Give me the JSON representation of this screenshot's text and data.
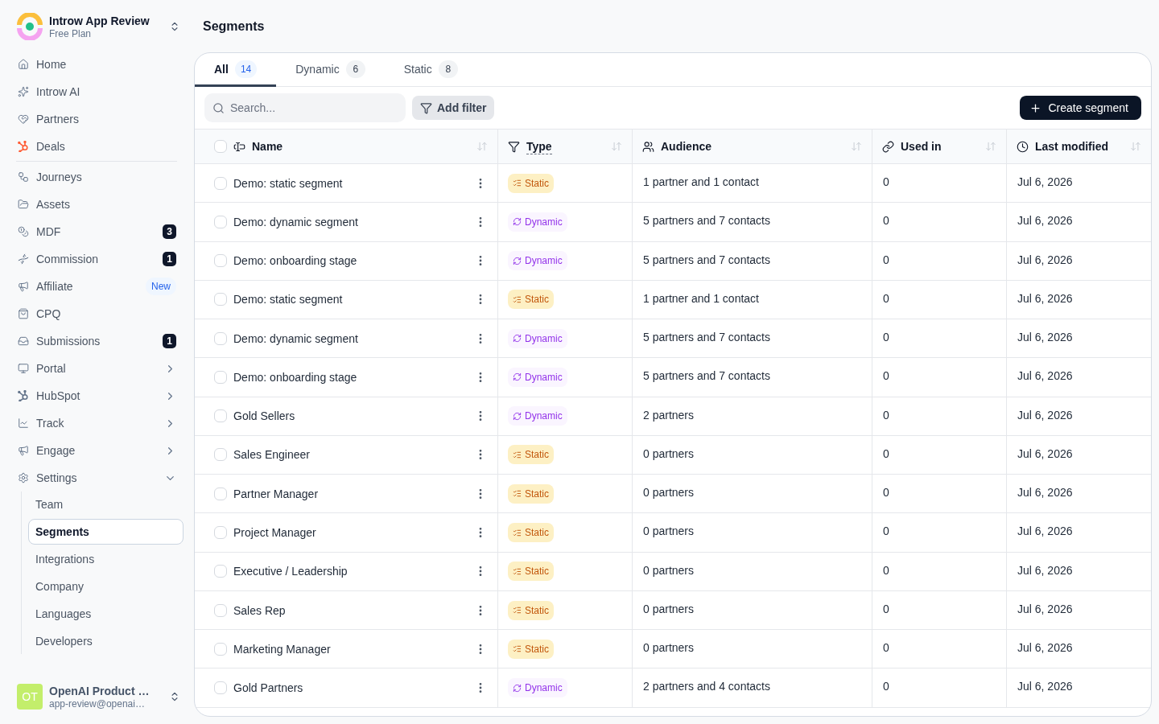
{
  "workspace": {
    "name": "Introw App Review",
    "plan": "Free Plan"
  },
  "sidebar": {
    "sections": [
      {
        "items": [
          {
            "label": "Home",
            "selected": false
          },
          {
            "label": "Introw AI",
            "selected": false
          },
          {
            "label": "Partners",
            "selected": false
          },
          {
            "label": "Deals",
            "selected": false
          }
        ]
      },
      {
        "items": [
          {
            "label": "Journeys",
            "selected": false
          },
          {
            "label": "Assets",
            "selected": false
          },
          {
            "label": "MDF",
            "selected": false,
            "badge": {
              "text": "3",
              "kind": "count"
            }
          },
          {
            "label": "Commission",
            "selected": false,
            "badge": {
              "text": "1",
              "kind": "count"
            }
          },
          {
            "label": "Affiliate",
            "selected": false,
            "badge": {
              "text": "New",
              "kind": "new"
            }
          },
          {
            "label": "CPQ",
            "selected": false
          },
          {
            "label": "Submissions",
            "selected": false,
            "badge": {
              "text": "1",
              "kind": "count"
            }
          },
          {
            "label": "Portal",
            "selected": false,
            "expanded": false
          },
          {
            "label": "HubSpot",
            "selected": false,
            "expanded": false
          },
          {
            "label": "Track",
            "selected": false,
            "expanded": false
          },
          {
            "label": "Engage",
            "selected": false,
            "expanded": false
          },
          {
            "label": "Settings",
            "selected": false,
            "expanded": true,
            "children": [
              {
                "label": "Team",
                "selected": false
              },
              {
                "label": "Segments",
                "selected": true
              },
              {
                "label": "Integrations",
                "selected": false
              },
              {
                "label": "Company",
                "selected": false
              },
              {
                "label": "Languages",
                "selected": false
              },
              {
                "label": "Developers",
                "selected": false
              }
            ]
          }
        ]
      }
    ]
  },
  "account": {
    "initials": "OT",
    "name": "OpenAI Product …",
    "email": "app-review@openai…"
  },
  "page": {
    "title": "Segments"
  },
  "tabs": [
    {
      "label": "All",
      "count": "14",
      "selected": true
    },
    {
      "label": "Dynamic",
      "count": "6",
      "selected": false
    },
    {
      "label": "Static",
      "count": "8",
      "selected": false
    }
  ],
  "toolbar": {
    "search": {
      "placeholder": "Search..."
    },
    "filter_button": "Add filter",
    "create_button": "Create segment"
  },
  "table": {
    "select_all_checked": false,
    "columns": [
      {
        "label": "Name",
        "underlined": false
      },
      {
        "label": "Type",
        "underlined": true
      },
      {
        "label": "Audience",
        "underlined": false
      },
      {
        "label": "Used in",
        "underlined": false
      },
      {
        "label": "Last modified",
        "underlined": false
      }
    ],
    "rows": [
      {
        "checked": false,
        "name": "Demo: static segment",
        "type": {
          "label": "Static",
          "kind": "static"
        },
        "audience": "1 partner and 1 contact",
        "used_in": "0",
        "last_modified": "Jul 6, 2026"
      },
      {
        "checked": false,
        "name": "Demo: dynamic segment",
        "type": {
          "label": "Dynamic",
          "kind": "dynamic"
        },
        "audience": "5 partners and 7 contacts",
        "used_in": "0",
        "last_modified": "Jul 6, 2026"
      },
      {
        "checked": false,
        "name": "Demo: onboarding stage",
        "type": {
          "label": "Dynamic",
          "kind": "dynamic"
        },
        "audience": "5 partners and 7 contacts",
        "used_in": "0",
        "last_modified": "Jul 6, 2026"
      },
      {
        "checked": false,
        "name": "Demo: static segment",
        "type": {
          "label": "Static",
          "kind": "static"
        },
        "audience": "1 partner and 1 contact",
        "used_in": "0",
        "last_modified": "Jul 6, 2026"
      },
      {
        "checked": false,
        "name": "Demo: dynamic segment",
        "type": {
          "label": "Dynamic",
          "kind": "dynamic"
        },
        "audience": "5 partners and 7 contacts",
        "used_in": "0",
        "last_modified": "Jul 6, 2026"
      },
      {
        "checked": false,
        "name": "Demo: onboarding stage",
        "type": {
          "label": "Dynamic",
          "kind": "dynamic"
        },
        "audience": "5 partners and 7 contacts",
        "used_in": "0",
        "last_modified": "Jul 6, 2026"
      },
      {
        "checked": false,
        "name": "Gold Sellers",
        "type": {
          "label": "Dynamic",
          "kind": "dynamic"
        },
        "audience": "2 partners",
        "used_in": "0",
        "last_modified": "Jul 6, 2026"
      },
      {
        "checked": false,
        "name": "Sales Engineer",
        "type": {
          "label": "Static",
          "kind": "static"
        },
        "audience": "0 partners",
        "used_in": "0",
        "last_modified": "Jul 6, 2026"
      },
      {
        "checked": false,
        "name": "Partner Manager",
        "type": {
          "label": "Static",
          "kind": "static"
        },
        "audience": "0 partners",
        "used_in": "0",
        "last_modified": "Jul 6, 2026"
      },
      {
        "checked": false,
        "name": "Project Manager",
        "type": {
          "label": "Static",
          "kind": "static"
        },
        "audience": "0 partners",
        "used_in": "0",
        "last_modified": "Jul 6, 2026"
      },
      {
        "checked": false,
        "name": "Executive / Leadership",
        "type": {
          "label": "Static",
          "kind": "static"
        },
        "audience": "0 partners",
        "used_in": "0",
        "last_modified": "Jul 6, 2026"
      },
      {
        "checked": false,
        "name": "Sales Rep",
        "type": {
          "label": "Static",
          "kind": "static"
        },
        "audience": "0 partners",
        "used_in": "0",
        "last_modified": "Jul 6, 2026"
      },
      {
        "checked": false,
        "name": "Marketing Manager",
        "type": {
          "label": "Static",
          "kind": "static"
        },
        "audience": "0 partners",
        "used_in": "0",
        "last_modified": "Jul 6, 2026"
      },
      {
        "checked": false,
        "name": "Gold Partners",
        "type": {
          "label": "Dynamic",
          "kind": "dynamic"
        },
        "audience": "2 partners and 4 contacts",
        "used_in": "0",
        "last_modified": "Jul 6, 2026"
      }
    ]
  }
}
